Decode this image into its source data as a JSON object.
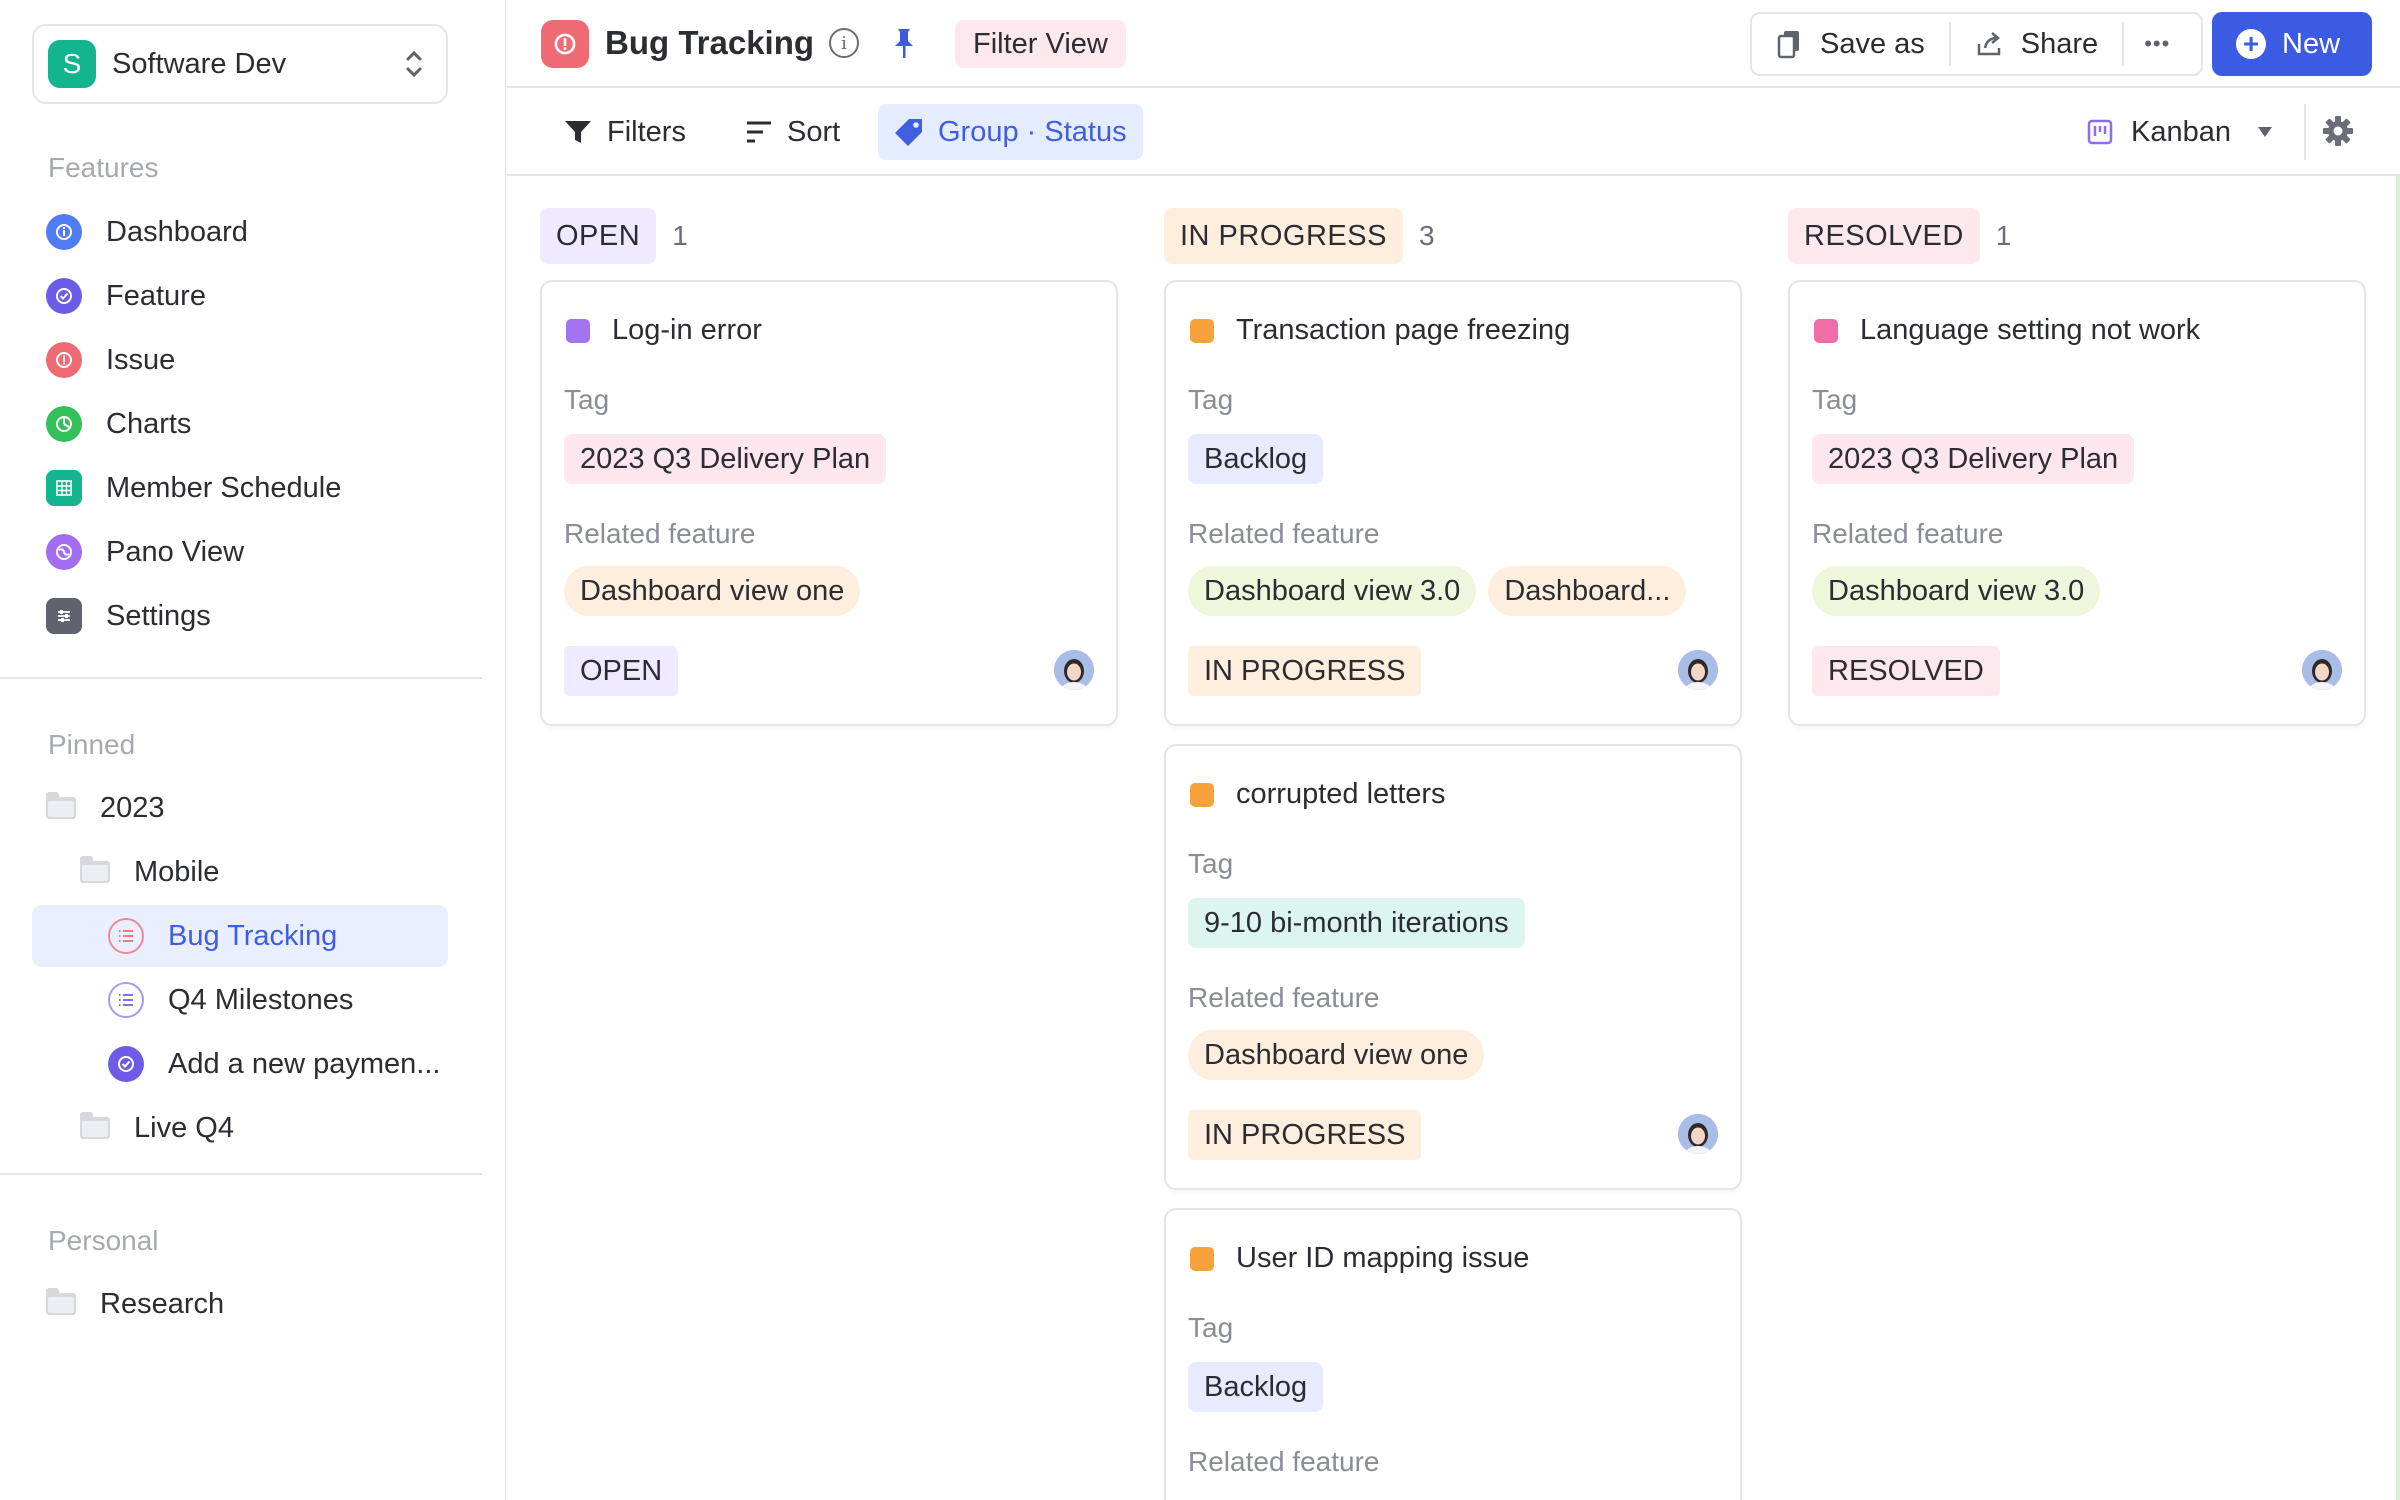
{
  "workspace": {
    "avatar_letter": "S",
    "name": "Software Dev"
  },
  "sidebar": {
    "features_title": "Features",
    "features": [
      {
        "label": "Dashboard",
        "icon": "dashboard-icon",
        "color": "#4f7cf2"
      },
      {
        "label": "Feature",
        "icon": "feature-icon",
        "color": "#6c5ce7"
      },
      {
        "label": "Issue",
        "icon": "issue-icon",
        "color": "#ef6b73"
      },
      {
        "label": "Charts",
        "icon": "charts-icon",
        "color": "#33c05a"
      },
      {
        "label": "Member Schedule",
        "icon": "schedule-icon",
        "color": "#14b58e"
      },
      {
        "label": "Pano View",
        "icon": "pano-icon",
        "color": "#a46cf0"
      },
      {
        "label": "Settings",
        "icon": "settings-icon",
        "color": "#5f636d"
      }
    ],
    "pinned_title": "Pinned",
    "pinned": [
      {
        "label": "2023"
      },
      {
        "label": "Mobile"
      },
      {
        "label": "Bug Tracking"
      },
      {
        "label": "Q4 Milestones"
      },
      {
        "label": "Add a new paymen..."
      },
      {
        "label": "Live Q4"
      }
    ],
    "personal_title": "Personal",
    "personal": [
      {
        "label": "Research"
      }
    ]
  },
  "header": {
    "title": "Bug Tracking",
    "filter_view_label": "Filter View",
    "save_as_label": "Save as",
    "share_label": "Share",
    "more_label": "•••",
    "new_label": "New"
  },
  "toolbar": {
    "filters_label": "Filters",
    "sort_label": "Sort",
    "group_label": "Group · Status",
    "view_label": "Kanban"
  },
  "board": {
    "columns": [
      {
        "label": "OPEN",
        "count": "1",
        "color": "#efeaff",
        "cards": [
          {
            "title": "Log-in error",
            "dot_color": "#a274f0",
            "tag_label": "Tag",
            "tags": [
              "2023 Q3 Delivery Plan"
            ],
            "feature_label": "Related feature",
            "features": [
              "Dashboard view one"
            ],
            "status": "OPEN"
          }
        ]
      },
      {
        "label": "IN PROGRESS",
        "count": "3",
        "color": "#feeede",
        "cards": [
          {
            "title": "Transaction page freezing",
            "dot_color": "#f7a23a",
            "tag_label": "Tag",
            "tags": [
              "Backlog"
            ],
            "feature_label": "Related feature",
            "features": [
              "Dashboard view 3.0",
              "Dashboard..."
            ],
            "status": "IN PROGRESS"
          },
          {
            "title": "corrupted letters",
            "dot_color": "#f7a23a",
            "tag_label": "Tag",
            "tags": [
              "9-10 bi-month iterations"
            ],
            "feature_label": "Related feature",
            "features": [
              "Dashboard view one"
            ],
            "status": "IN PROGRESS"
          },
          {
            "title": "User ID mapping issue",
            "dot_color": "#f7a23a",
            "tag_label": "Tag",
            "tags": [
              "Backlog"
            ],
            "feature_label": "Related feature"
          }
        ]
      },
      {
        "label": "RESOLVED",
        "count": "1",
        "color": "#fde8ee",
        "cards": [
          {
            "title": "Language setting not work",
            "dot_color": "#f06ea8",
            "tag_label": "Tag",
            "tags": [
              "2023 Q3 Delivery Plan"
            ],
            "feature_label": "Related feature",
            "features": [
              "Dashboard view 3.0"
            ],
            "status": "RESOLVED"
          }
        ]
      }
    ]
  }
}
